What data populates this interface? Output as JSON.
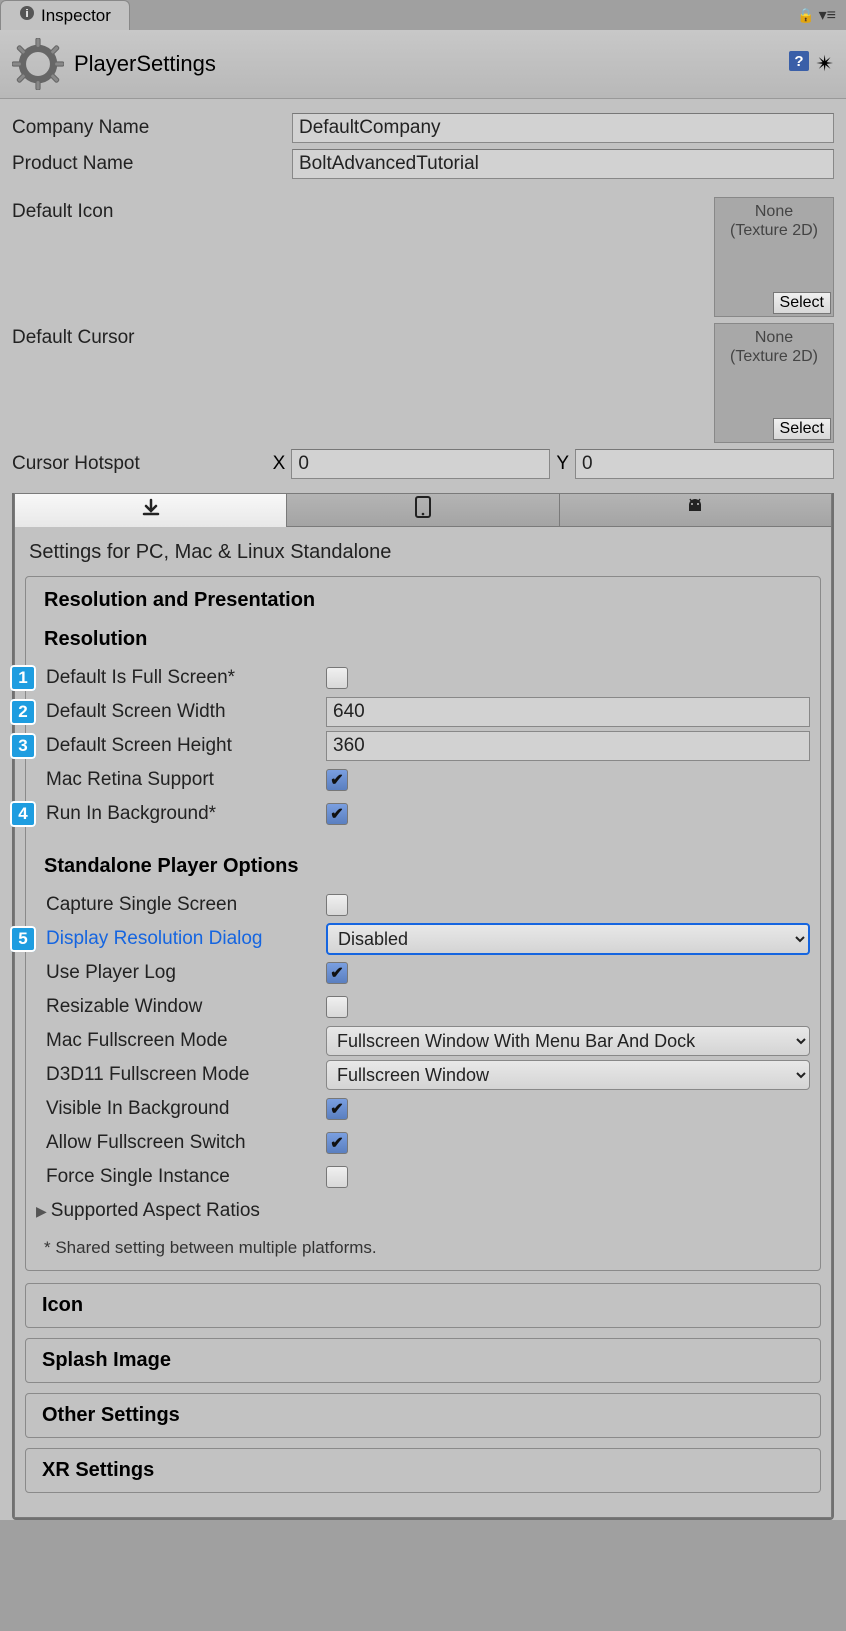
{
  "tab_title": "Inspector",
  "title": "PlayerSettings",
  "props": {
    "company_label": "Company Name",
    "company_value": "DefaultCompany",
    "product_label": "Product Name",
    "product_value": "BoltAdvancedTutorial",
    "default_icon_label": "Default Icon",
    "default_cursor_label": "Default Cursor",
    "tex_none": "None",
    "tex_type": "(Texture 2D)",
    "select_btn": "Select",
    "cursor_hotspot_label": "Cursor Hotspot",
    "hotspot_x_label": "X",
    "hotspot_x": "0",
    "hotspot_y_label": "Y",
    "hotspot_y": "0"
  },
  "settings_for": "Settings for PC, Mac & Linux Standalone",
  "section_resolution_presentation": "Resolution and Presentation",
  "resolution": {
    "header": "Resolution",
    "fullscreen_label": "Default Is Full Screen*",
    "width_label": "Default Screen Width",
    "width_value": "640",
    "height_label": "Default Screen Height",
    "height_value": "360",
    "retina_label": "Mac Retina Support",
    "runbg_label": "Run In Background*"
  },
  "standalone": {
    "header": "Standalone Player Options",
    "capture_label": "Capture Single Screen",
    "display_dialog_label": "Display Resolution Dialog",
    "display_dialog_value": "Disabled",
    "playerlog_label": "Use Player Log",
    "resizable_label": "Resizable Window",
    "mac_fs_label": "Mac Fullscreen Mode",
    "mac_fs_value": "Fullscreen Window With Menu Bar And Dock",
    "d3d_label": "D3D11 Fullscreen Mode",
    "d3d_value": "Fullscreen Window",
    "visible_bg_label": "Visible In Background",
    "allow_fs_label": "Allow Fullscreen Switch",
    "force_single_label": "Force Single Instance",
    "aspect_label": "Supported Aspect Ratios"
  },
  "footnote": "* Shared setting between multiple platforms.",
  "collapsed": {
    "icon": "Icon",
    "splash": "Splash Image",
    "other": "Other Settings",
    "xr": "XR Settings"
  },
  "annotations": [
    "1",
    "2",
    "3",
    "4",
    "5"
  ]
}
